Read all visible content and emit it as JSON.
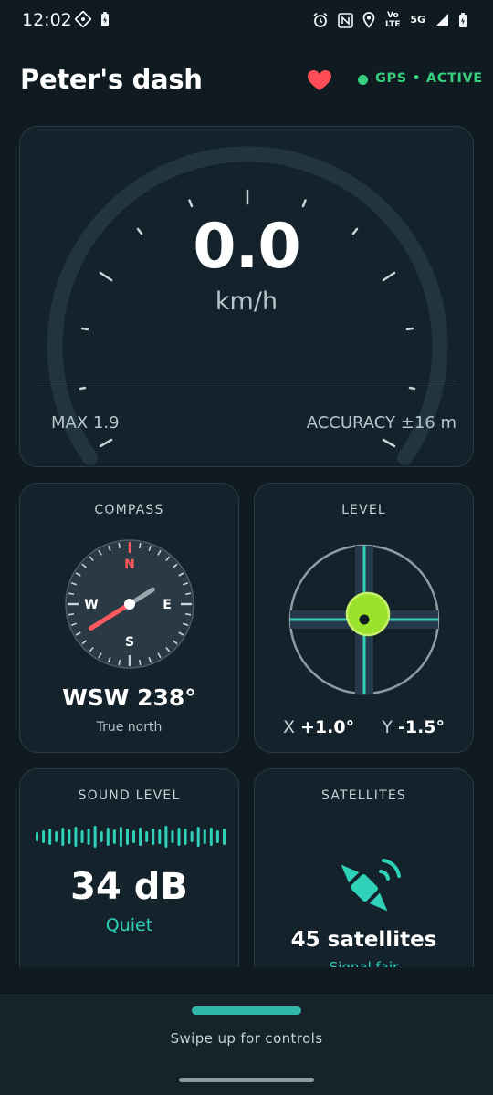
{
  "status_bar": {
    "time": "12:02",
    "network": "5G",
    "volte": "Vo LTE",
    "icons": [
      "grid-app-icon",
      "battery-saver-icon",
      "alarm-icon",
      "nfc-icon",
      "location-icon",
      "volte-icon",
      "signal-icon",
      "battery-icon"
    ]
  },
  "header": {
    "title": "Peter's dash",
    "favorite_icon": "heart-icon",
    "gps_status": "GPS • ACTIVE"
  },
  "speed": {
    "value": "0.0",
    "unit": "km/h",
    "max": "MAX 1.9",
    "accuracy": "ACCURACY ±16 m"
  },
  "compass": {
    "title": "COMPASS",
    "heading": "WSW 238°",
    "heading_degrees": 238,
    "sub": "True north",
    "cardinals": {
      "n": "N",
      "e": "E",
      "s": "S",
      "w": "W"
    }
  },
  "level": {
    "title": "LEVEL",
    "x_label": "X",
    "x_value": "+1.0°",
    "y_label": "Y",
    "y_value": "-1.5°"
  },
  "sound": {
    "title": "SOUND LEVEL",
    "value": "34 dB",
    "label": "Quiet"
  },
  "satellites": {
    "title": "SATELLITES",
    "icon": "satellite-icon",
    "count": "45 satellites",
    "signal": "Signal fair"
  },
  "bottom_sheet": {
    "hint": "Swipe up for controls"
  },
  "colors": {
    "background": "#0f1a21",
    "card": "#13222b",
    "accent_teal": "#2fd1b8",
    "gps_green": "#35d07f",
    "heart_red": "#ff4d57",
    "needle_red": "#ff5a5f",
    "level_bubble": "#9be22d"
  }
}
